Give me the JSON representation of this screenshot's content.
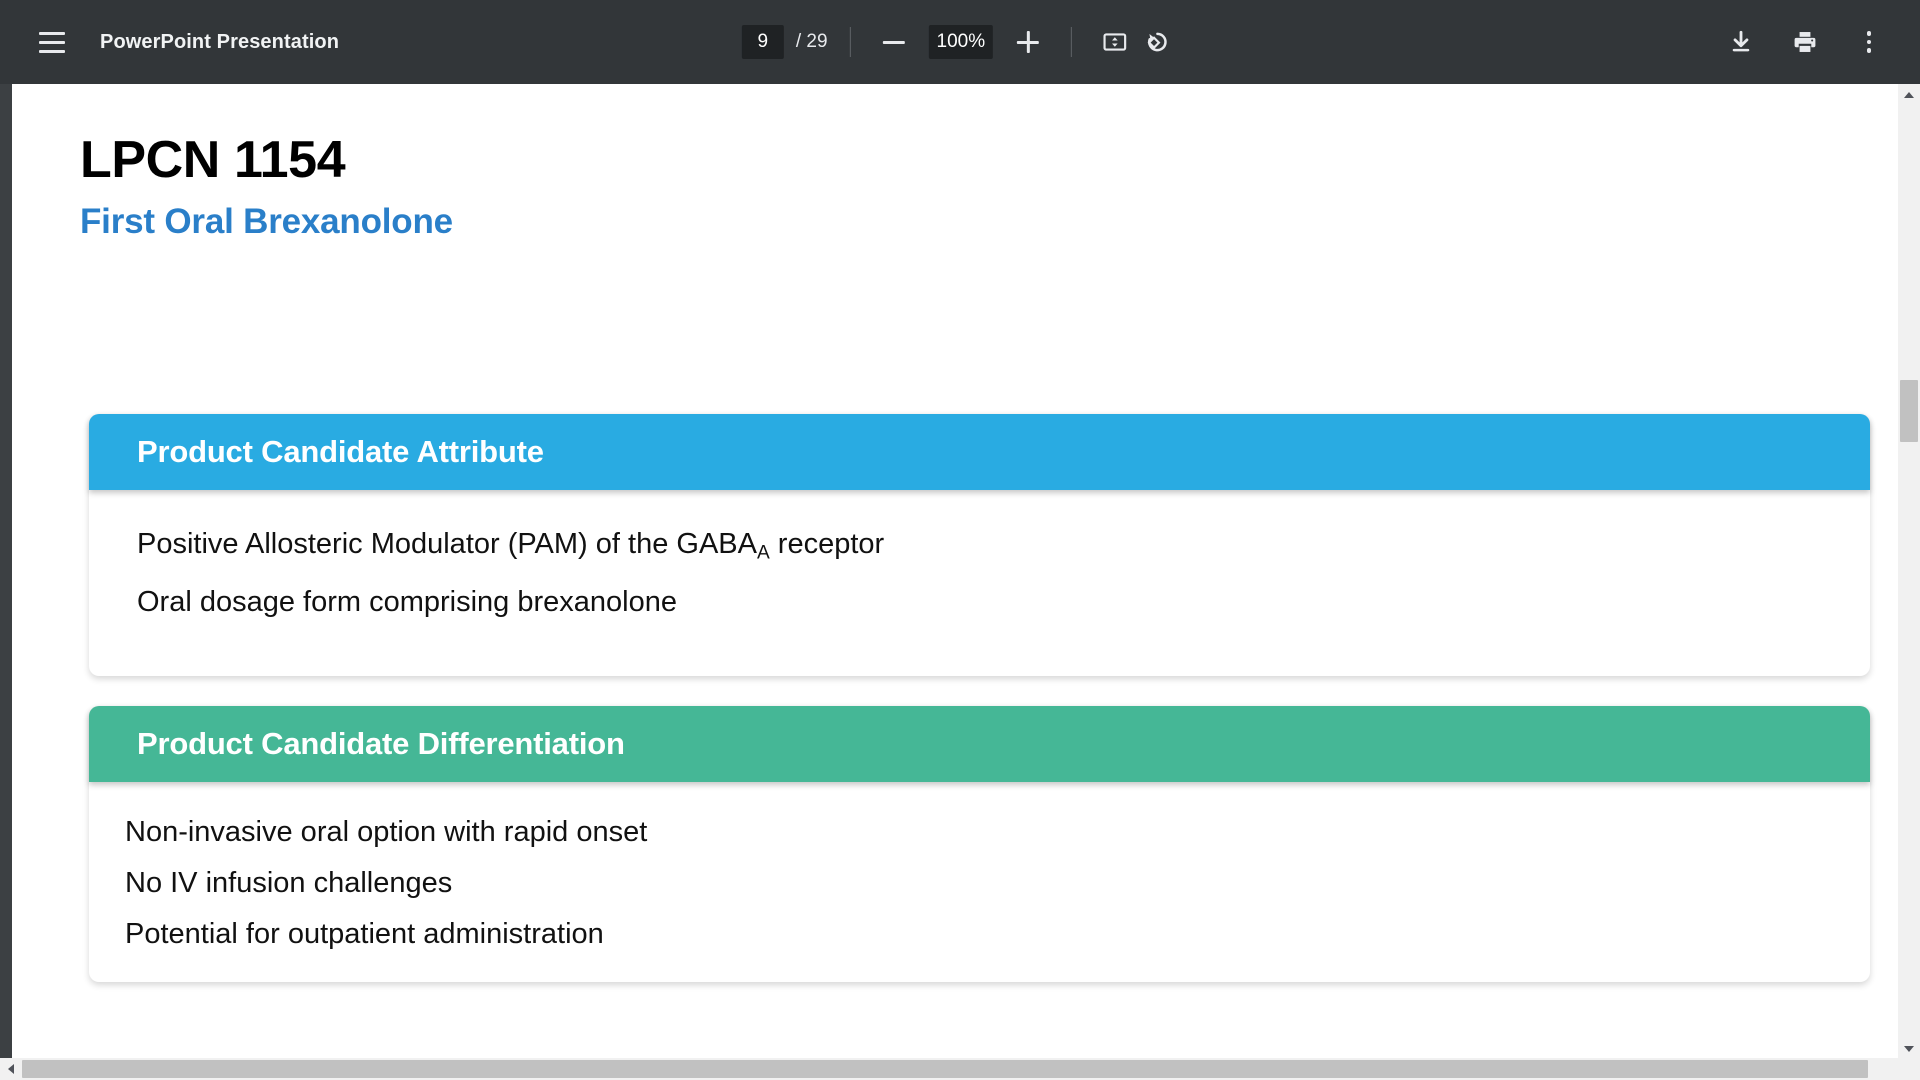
{
  "toolbar": {
    "menu_icon": "hamburger-menu-icon",
    "document_title": "PowerPoint Presentation",
    "current_page": "9",
    "page_total": "/ 29",
    "zoom_out_icon": "minus-icon",
    "zoom_level": "100%",
    "zoom_in_icon": "plus-icon",
    "fit_page_icon": "fit-to-page-icon",
    "rotate_icon": "rotate-counterclockwise-icon",
    "download_icon": "download-icon",
    "print_icon": "print-icon",
    "more_icon": "more-options-icon"
  },
  "slide": {
    "title": "LPCN 1154",
    "subtitle": "First Oral Brexanolone",
    "cards": [
      {
        "header": "Product Candidate Attribute",
        "header_color": "#29ABE2",
        "lines": [
          {
            "prefix": "Positive Allosteric Modulator (PAM) of the GABA",
            "sub": "A",
            "suffix": " receptor"
          },
          {
            "prefix": "Oral dosage form comprising brexanolone",
            "sub": "",
            "suffix": ""
          }
        ]
      },
      {
        "header": "Product Candidate Differentiation",
        "header_color": "#45B796",
        "lines": [
          {
            "prefix": "Non-invasive oral option with rapid onset",
            "sub": "",
            "suffix": ""
          },
          {
            "prefix": "No IV infusion challenges",
            "sub": "",
            "suffix": ""
          },
          {
            "prefix": "Potential for outpatient administration",
            "sub": "",
            "suffix": ""
          }
        ]
      }
    ]
  },
  "scrollbars": {
    "vertical_up_icon": "scroll-up-arrow-icon",
    "vertical_down_icon": "scroll-down-arrow-icon",
    "horizontal_left_icon": "scroll-left-arrow-icon",
    "horizontal_right_icon": "scroll-right-arrow-icon"
  },
  "colors": {
    "toolbar_bg": "#323639",
    "title_black": "#000000",
    "subtitle_blue": "#2A7FC9",
    "card_blue": "#29ABE2",
    "card_green": "#45B796"
  }
}
